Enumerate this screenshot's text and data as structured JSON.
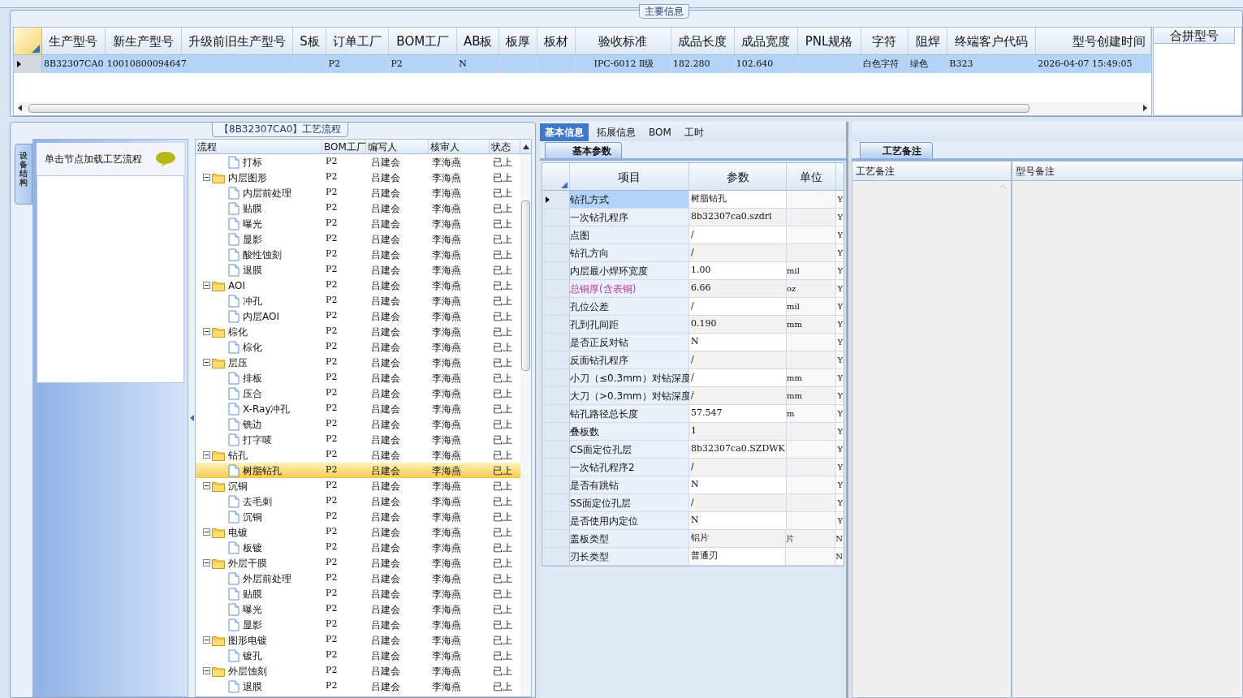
{
  "main_info": {
    "title": "主要信息",
    "columns": [
      "生产型号",
      "新生产型号",
      "升级前旧生产型号",
      "S板",
      "订单工厂",
      "BOM工厂",
      "AB板",
      "板厚",
      "板材",
      "验收标准",
      "成品长度",
      "成品宽度",
      "PNL规格",
      "字符",
      "阻焊",
      "终端客户代码",
      "型号创建时间"
    ],
    "rows": [
      {
        "selected": true,
        "cells": [
          "8B32307CA0",
          "10010800094647",
          null,
          null,
          "P2",
          "P2",
          "N",
          null,
          null,
          "IPC-6012 Ⅱ级",
          "182.280",
          "102.640",
          null,
          "白色字符",
          "绿色",
          "B323",
          "2026-04-07 15:49:05"
        ]
      }
    ],
    "side_column": "合拼型号"
  },
  "process_panel": {
    "title": "【8B32307CA0】工艺流程",
    "side_tab": "设备结构",
    "hint": "单击节点加载工艺流程",
    "columns": [
      "流程",
      "BOM工厂",
      "编写人",
      "核审人",
      "状态"
    ],
    "tree": [
      {
        "label": "打标",
        "kind": "step",
        "bom_factory": "P2",
        "author": "吕建会",
        "reviewer": "李海燕",
        "status": "已上",
        "selected": false
      },
      {
        "label": "内层图形",
        "kind": "group",
        "expanded": true,
        "bom_factory": "P2",
        "author": "吕建会",
        "reviewer": "李海燕",
        "status": "已上",
        "selected": false,
        "children": [
          {
            "label": "内层前处理",
            "kind": "step",
            "bom_factory": "P2",
            "author": "吕建会",
            "reviewer": "李海燕",
            "status": "已上",
            "selected": false
          },
          {
            "label": "贴膜",
            "kind": "step",
            "bom_factory": "P2",
            "author": "吕建会",
            "reviewer": "李海燕",
            "status": "已上",
            "selected": false
          },
          {
            "label": "曝光",
            "kind": "step",
            "bom_factory": "P2",
            "author": "吕建会",
            "reviewer": "李海燕",
            "status": "已上",
            "selected": false
          },
          {
            "label": "显影",
            "kind": "step",
            "bom_factory": "P2",
            "author": "吕建会",
            "reviewer": "李海燕",
            "status": "已上",
            "selected": false
          },
          {
            "label": "酸性蚀刻",
            "kind": "step",
            "bom_factory": "P2",
            "author": "吕建会",
            "reviewer": "李海燕",
            "status": "已上",
            "selected": false
          },
          {
            "label": "退膜",
            "kind": "step",
            "bom_factory": "P2",
            "author": "吕建会",
            "reviewer": "李海燕",
            "status": "已上",
            "selected": false
          }
        ]
      },
      {
        "label": "AOI",
        "kind": "group",
        "expanded": true,
        "bom_factory": "P2",
        "author": "吕建会",
        "reviewer": "李海燕",
        "status": "已上",
        "selected": false,
        "children": [
          {
            "label": "冲孔",
            "kind": "step",
            "bom_factory": "P2",
            "author": "吕建会",
            "reviewer": "李海燕",
            "status": "已上",
            "selected": false
          },
          {
            "label": "内层AOI",
            "kind": "step",
            "bom_factory": "P2",
            "author": "吕建会",
            "reviewer": "李海燕",
            "status": "已上",
            "selected": false
          }
        ]
      },
      {
        "label": "棕化",
        "kind": "group",
        "expanded": true,
        "bom_factory": "P2",
        "author": "吕建会",
        "reviewer": "李海燕",
        "status": "已上",
        "selected": false,
        "children": [
          {
            "label": "棕化",
            "kind": "step",
            "bom_factory": "P2",
            "author": "吕建会",
            "reviewer": "李海燕",
            "status": "已上",
            "selected": false
          }
        ]
      },
      {
        "label": "层压",
        "kind": "group",
        "expanded": true,
        "bom_factory": "P2",
        "author": "吕建会",
        "reviewer": "李海燕",
        "status": "已上",
        "selected": false,
        "children": [
          {
            "label": "排板",
            "kind": "step",
            "bom_factory": "P2",
            "author": "吕建会",
            "reviewer": "李海燕",
            "status": "已上",
            "selected": false
          },
          {
            "label": "压合",
            "kind": "step",
            "bom_factory": "P2",
            "author": "吕建会",
            "reviewer": "李海燕",
            "status": "已上",
            "selected": false
          },
          {
            "label": "X-Ray冲孔",
            "kind": "step",
            "bom_factory": "P2",
            "author": "吕建会",
            "reviewer": "李海燕",
            "status": "已上",
            "selected": false
          },
          {
            "label": "铣边",
            "kind": "step",
            "bom_factory": "P2",
            "author": "吕建会",
            "reviewer": "李海燕",
            "status": "已上",
            "selected": false
          },
          {
            "label": "打字唛",
            "kind": "step",
            "bom_factory": "P2",
            "author": "吕建会",
            "reviewer": "李海燕",
            "status": "已上",
            "selected": false
          }
        ]
      },
      {
        "label": "钻孔",
        "kind": "group",
        "expanded": true,
        "bom_factory": "P2",
        "author": "吕建会",
        "reviewer": "李海燕",
        "status": "已上",
        "selected": false,
        "children": [
          {
            "label": "树脂钻孔",
            "kind": "step",
            "bom_factory": "P2",
            "author": "吕建会",
            "reviewer": "李海燕",
            "status": "已上",
            "selected": true
          }
        ]
      },
      {
        "label": "沉铜",
        "kind": "group",
        "expanded": true,
        "bom_factory": "P2",
        "author": "吕建会",
        "reviewer": "李海燕",
        "status": "已上",
        "selected": false,
        "children": [
          {
            "label": "去毛刺",
            "kind": "step",
            "bom_factory": "P2",
            "author": "吕建会",
            "reviewer": "李海燕",
            "status": "已上",
            "selected": false
          },
          {
            "label": "沉铜",
            "kind": "step",
            "bom_factory": "P2",
            "author": "吕建会",
            "reviewer": "李海燕",
            "status": "已上",
            "selected": false
          }
        ]
      },
      {
        "label": "电镀",
        "kind": "group",
        "expanded": true,
        "bom_factory": "P2",
        "author": "吕建会",
        "reviewer": "李海燕",
        "status": "已上",
        "selected": false,
        "children": [
          {
            "label": "板镀",
            "kind": "step",
            "bom_factory": "P2",
            "author": "吕建会",
            "reviewer": "李海燕",
            "status": "已上",
            "selected": false
          }
        ]
      },
      {
        "label": "外层干膜",
        "kind": "group",
        "expanded": true,
        "bom_factory": "P2",
        "author": "吕建会",
        "reviewer": "李海燕",
        "status": "已上",
        "selected": false,
        "children": [
          {
            "label": "外层前处理",
            "kind": "step",
            "bom_factory": "P2",
            "author": "吕建会",
            "reviewer": "李海燕",
            "status": "已上",
            "selected": false
          },
          {
            "label": "贴膜",
            "kind": "step",
            "bom_factory": "P2",
            "author": "吕建会",
            "reviewer": "李海燕",
            "status": "已上",
            "selected": false
          },
          {
            "label": "曝光",
            "kind": "step",
            "bom_factory": "P2",
            "author": "吕建会",
            "reviewer": "李海燕",
            "status": "已上",
            "selected": false
          },
          {
            "label": "显影",
            "kind": "step",
            "bom_factory": "P2",
            "author": "吕建会",
            "reviewer": "李海燕",
            "status": "已上",
            "selected": false
          }
        ]
      },
      {
        "label": "图形电镀",
        "kind": "group",
        "expanded": true,
        "bom_factory": "P2",
        "author": "吕建会",
        "reviewer": "李海燕",
        "status": "已上",
        "selected": false,
        "children": [
          {
            "label": "镀孔",
            "kind": "step",
            "bom_factory": "P2",
            "author": "吕建会",
            "reviewer": "李海燕",
            "status": "已上",
            "selected": false
          }
        ]
      },
      {
        "label": "外层蚀刻",
        "kind": "group",
        "expanded": true,
        "bom_factory": "P2",
        "author": "吕建会",
        "reviewer": "李海燕",
        "status": "已上",
        "selected": false,
        "children": [
          {
            "label": "退膜",
            "kind": "step",
            "bom_factory": "P2",
            "author": "吕建会",
            "reviewer": "李海燕",
            "status": "已上",
            "selected": false
          }
        ]
      }
    ]
  },
  "detail_tabs": [
    {
      "label": "基本信息",
      "selected": true
    },
    {
      "label": "拓展信息",
      "selected": false
    },
    {
      "label": "BOM",
      "selected": false
    },
    {
      "label": "工时",
      "selected": false
    }
  ],
  "param_tabs": [
    {
      "label": "基本参数",
      "selected": true
    }
  ],
  "params": {
    "columns": [
      "项目",
      "参数",
      "单位"
    ],
    "rows": [
      {
        "item": "钻孔方式",
        "value": "树脂钻孔",
        "unit": null,
        "column_4": "Y",
        "selected": true,
        "emphasis": false
      },
      {
        "item": "一次钻孔程序",
        "value": "8b32307ca0.szdrl",
        "unit": null,
        "column_4": "Y",
        "selected": false,
        "emphasis": false
      },
      {
        "item": "点图",
        "value": "/",
        "unit": null,
        "column_4": "Y",
        "selected": false,
        "emphasis": false
      },
      {
        "item": "钻孔方向",
        "value": "/",
        "unit": null,
        "column_4": "Y",
        "selected": false,
        "emphasis": false
      },
      {
        "item": "内层最小焊环宽度",
        "value": "1.00",
        "unit": "mil",
        "column_4": "Y",
        "selected": false,
        "emphasis": false
      },
      {
        "item": "总铜厚(含表铜)",
        "value": "6.66",
        "unit": "oz",
        "column_4": "Y",
        "selected": false,
        "emphasis": true
      },
      {
        "item": "孔位公差",
        "value": "/",
        "unit": "mil",
        "column_4": "Y",
        "selected": false,
        "emphasis": false
      },
      {
        "item": "孔到孔间距",
        "value": "0.190",
        "unit": "mm",
        "column_4": "Y",
        "selected": false,
        "emphasis": false
      },
      {
        "item": "是否正反对钻",
        "value": "N",
        "unit": null,
        "column_4": "Y",
        "selected": false,
        "emphasis": false
      },
      {
        "item": "反面钻孔程序",
        "value": "/",
        "unit": null,
        "column_4": "Y",
        "selected": false,
        "emphasis": false
      },
      {
        "item": "小刀（≤0.3mm）对钻深度",
        "value": "/",
        "unit": "mm",
        "column_4": "Y",
        "selected": false,
        "emphasis": false
      },
      {
        "item": "大刀（>0.3mm）对钻深度",
        "value": "/",
        "unit": "mm",
        "column_4": "Y",
        "selected": false,
        "emphasis": false
      },
      {
        "item": "钻孔路径总长度",
        "value": "57.547",
        "unit": "m",
        "column_4": "Y",
        "selected": false,
        "emphasis": false
      },
      {
        "item": "叠板数",
        "value": "1",
        "unit": null,
        "column_4": "Y",
        "selected": false,
        "emphasis": false
      },
      {
        "item": "CS面定位孔层",
        "value": "8b32307ca0.SZDWK",
        "unit": null,
        "column_4": "Y",
        "selected": false,
        "emphasis": false
      },
      {
        "item": "一次钻孔程序2",
        "value": "/",
        "unit": null,
        "column_4": "Y",
        "selected": false,
        "emphasis": false
      },
      {
        "item": "是否有跳钻",
        "value": "N",
        "unit": null,
        "column_4": "Y",
        "selected": false,
        "emphasis": false
      },
      {
        "item": "SS面定位孔层",
        "value": "/",
        "unit": null,
        "column_4": "Y",
        "selected": false,
        "emphasis": false
      },
      {
        "item": "是否使用内定位",
        "value": "N",
        "unit": null,
        "column_4": "Y",
        "selected": false,
        "emphasis": false
      },
      {
        "item": "盖板类型",
        "value": "铝片",
        "unit": "片",
        "column_4": "N",
        "selected": false,
        "emphasis": false
      },
      {
        "item": "刃长类型",
        "value": "普通刃",
        "unit": null,
        "column_4": "N",
        "selected": false,
        "emphasis": false
      }
    ]
  },
  "notes": {
    "tabs": [
      {
        "label": "工艺备注",
        "selected": true
      }
    ],
    "columns": [
      "工艺备注",
      "型号备注"
    ]
  }
}
